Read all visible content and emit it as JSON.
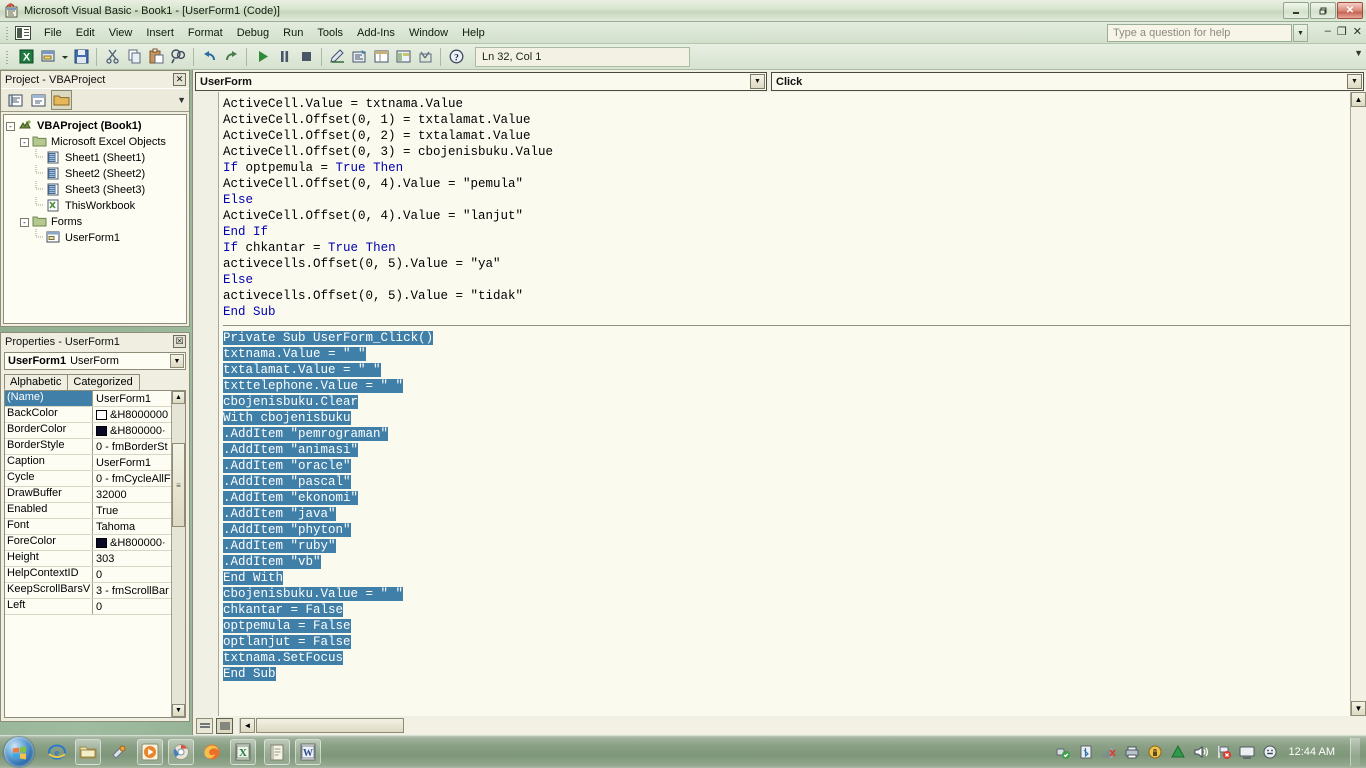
{
  "window": {
    "title": "Microsoft Visual Basic - Book1 - [UserForm1 (Code)]",
    "app_icon": "visual-basic-icon",
    "minimize": "–",
    "maximize": "❐",
    "close": "✕"
  },
  "menu": {
    "items": [
      {
        "label": "File",
        "accel": "F"
      },
      {
        "label": "Edit",
        "accel": "E"
      },
      {
        "label": "View",
        "accel": "V"
      },
      {
        "label": "Insert",
        "accel": "I"
      },
      {
        "label": "Format",
        "accel": "o"
      },
      {
        "label": "Debug",
        "accel": "D"
      },
      {
        "label": "Run",
        "accel": "R"
      },
      {
        "label": "Tools",
        "accel": "T"
      },
      {
        "label": "Add-Ins",
        "accel": "A"
      },
      {
        "label": "Window",
        "accel": "W"
      },
      {
        "label": "Help",
        "accel": "H"
      }
    ],
    "help_placeholder": "Type a question for help",
    "mdi_minimize": "–",
    "mdi_restore": "❐",
    "mdi_close": "✕"
  },
  "toolbar": {
    "position_label": "Ln 32, Col 1",
    "buttons": [
      "view-excel-icon",
      "insert-userform-icon",
      "save-icon",
      "cut-icon",
      "copy-icon",
      "paste-icon",
      "find-icon",
      "undo-icon",
      "redo-icon",
      "run-icon",
      "break-icon",
      "reset-icon",
      "design-mode-icon",
      "project-explorer-icon",
      "properties-window-icon",
      "object-browser-icon",
      "toolbox-icon",
      "help-icon"
    ]
  },
  "project_panel": {
    "caption": "Project - VBAProject",
    "close_label": "✕",
    "toolbar_buttons": [
      "view-code-icon",
      "view-object-icon",
      "toggle-folders-icon"
    ],
    "tree": [
      {
        "label": "VBAProject (Book1)",
        "icon": "vba-project-icon",
        "depth": 0,
        "expander": "-",
        "bold": true
      },
      {
        "label": "Microsoft Excel Objects",
        "icon": "folder-icon",
        "depth": 1,
        "expander": "-",
        "bold": false
      },
      {
        "label": "Sheet1 (Sheet1)",
        "icon": "worksheet-icon",
        "depth": 2,
        "expander": "",
        "bold": false
      },
      {
        "label": "Sheet2 (Sheet2)",
        "icon": "worksheet-icon",
        "depth": 2,
        "expander": "",
        "bold": false
      },
      {
        "label": "Sheet3 (Sheet3)",
        "icon": "worksheet-icon",
        "depth": 2,
        "expander": "",
        "bold": false
      },
      {
        "label": "ThisWorkbook",
        "icon": "workbook-icon",
        "depth": 2,
        "expander": "",
        "bold": false
      },
      {
        "label": "Forms",
        "icon": "folder-icon",
        "depth": 1,
        "expander": "-",
        "bold": false
      },
      {
        "label": "UserForm1",
        "icon": "userform-icon",
        "depth": 2,
        "expander": "",
        "bold": false
      }
    ]
  },
  "properties_panel": {
    "caption": "Properties - UserForm1",
    "close_label": "☒",
    "object_name": "UserForm1",
    "object_type": "UserForm",
    "tabs": [
      {
        "label": "Alphabetic",
        "selected": true
      },
      {
        "label": "Categorized",
        "selected": false
      }
    ],
    "rows": [
      {
        "name": "(Name)",
        "value": "UserForm1",
        "selected": true,
        "swatch": null
      },
      {
        "name": "BackColor",
        "value": "&H8000000",
        "selected": false,
        "swatch": "#ffffff"
      },
      {
        "name": "BorderColor",
        "value": "&H800000·",
        "selected": false,
        "swatch": "#0a0a28"
      },
      {
        "name": "BorderStyle",
        "value": "0 - fmBorderSt",
        "selected": false,
        "swatch": null
      },
      {
        "name": "Caption",
        "value": "UserForm1",
        "selected": false,
        "swatch": null
      },
      {
        "name": "Cycle",
        "value": "0 - fmCycleAllF",
        "selected": false,
        "swatch": null
      },
      {
        "name": "DrawBuffer",
        "value": "32000",
        "selected": false,
        "swatch": null
      },
      {
        "name": "Enabled",
        "value": "True",
        "selected": false,
        "swatch": null
      },
      {
        "name": "Font",
        "value": "Tahoma",
        "selected": false,
        "swatch": null
      },
      {
        "name": "ForeColor",
        "value": "&H800000·",
        "selected": false,
        "swatch": "#0a0a28"
      },
      {
        "name": "Height",
        "value": "303",
        "selected": false,
        "swatch": null
      },
      {
        "name": "HelpContextID",
        "value": "0",
        "selected": false,
        "swatch": null
      },
      {
        "name": "KeepScrollBarsV",
        "value": "3 - fmScrollBar",
        "selected": false,
        "swatch": null
      },
      {
        "name": "Left",
        "value": "0",
        "selected": false,
        "swatch": null
      }
    ]
  },
  "code_window": {
    "object_combo": "UserForm",
    "procedure_combo": "Click",
    "arrow": "▼",
    "lines": [
      {
        "text": "ActiveCell.Value = txtnama.Value",
        "selected": false,
        "kw": []
      },
      {
        "text": "ActiveCell.Offset(0, 1) = txtalamat.Value",
        "selected": false,
        "kw": []
      },
      {
        "text": "ActiveCell.Offset(0, 2) = txtalamat.Value",
        "selected": false,
        "kw": []
      },
      {
        "text": "ActiveCell.Offset(0, 3) = cbojenisbuku.Value",
        "selected": false,
        "kw": []
      },
      {
        "text": "If optpemula = True Then",
        "selected": false,
        "kw": [
          "If",
          "True",
          "Then"
        ]
      },
      {
        "text": "ActiveCell.Offset(0, 4).Value = \"pemula\"",
        "selected": false,
        "kw": []
      },
      {
        "text": "Else",
        "selected": false,
        "kw": [
          "Else"
        ]
      },
      {
        "text": "ActiveCell.Offset(0, 4).Value = \"lanjut\"",
        "selected": false,
        "kw": []
      },
      {
        "text": "End If",
        "selected": false,
        "kw": [
          "End",
          "If"
        ]
      },
      {
        "text": "If chkantar = True Then",
        "selected": false,
        "kw": [
          "If",
          "True",
          "Then"
        ]
      },
      {
        "text": "activecells.Offset(0, 5).Value = \"ya\"",
        "selected": false,
        "kw": []
      },
      {
        "text": "Else",
        "selected": false,
        "kw": [
          "Else"
        ]
      },
      {
        "text": "activecells.Offset(0, 5).Value = \"tidak\"",
        "selected": false,
        "kw": []
      },
      {
        "text": "End Sub",
        "selected": false,
        "kw": [
          "End",
          "Sub"
        ]
      },
      {
        "separator": true
      },
      {
        "text": "Private Sub UserForm_Click()",
        "selected": true,
        "kw": [
          "Private",
          "Sub"
        ]
      },
      {
        "text": "txtnama.Value = \" \"",
        "selected": true,
        "kw": []
      },
      {
        "text": "txtalamat.Value = \" \"",
        "selected": true,
        "kw": []
      },
      {
        "text": "txttelephone.Value = \" \"",
        "selected": true,
        "kw": []
      },
      {
        "text": "cbojenisbuku.Clear",
        "selected": true,
        "kw": []
      },
      {
        "text": "With cbojenisbuku",
        "selected": true,
        "kw": [
          "With"
        ]
      },
      {
        "text": ".AddItem \"pemrograman\"",
        "selected": true,
        "kw": []
      },
      {
        "text": ".AddItem \"animasi\"",
        "selected": true,
        "kw": []
      },
      {
        "text": ".AddItem \"oracle\"",
        "selected": true,
        "kw": []
      },
      {
        "text": ".AddItem \"pascal\"",
        "selected": true,
        "kw": []
      },
      {
        "text": ".AddItem \"ekonomi\"",
        "selected": true,
        "kw": []
      },
      {
        "text": ".AddItem \"java\"",
        "selected": true,
        "kw": []
      },
      {
        "text": ".AddItem \"phyton\"",
        "selected": true,
        "kw": []
      },
      {
        "text": ".AddItem \"ruby\"",
        "selected": true,
        "kw": []
      },
      {
        "text": ".AddItem \"vb\"",
        "selected": true,
        "kw": []
      },
      {
        "text": "End With",
        "selected": true,
        "kw": [
          "End",
          "With"
        ]
      },
      {
        "text": "cbojenisbuku.Value = \" \"",
        "selected": true,
        "kw": []
      },
      {
        "text": "chkantar = False",
        "selected": true,
        "kw": [
          "False"
        ]
      },
      {
        "text": "optpemula = False",
        "selected": true,
        "kw": [
          "False"
        ]
      },
      {
        "text": "optlanjut = False",
        "selected": true,
        "kw": [
          "False"
        ]
      },
      {
        "text": "txtnama.SetFocus",
        "selected": true,
        "kw": []
      },
      {
        "text": "End Sub",
        "selected": true,
        "kw": [
          "End",
          "Sub"
        ]
      }
    ],
    "view_buttons": [
      "procedure-view-icon",
      "full-module-view-icon"
    ],
    "scroll_up": "▲",
    "scroll_down": "▼",
    "scroll_left": "◄",
    "scroll_right": "►"
  },
  "taskbar": {
    "start": "windows-start-orb",
    "quick_launch": [
      "internet-explorer-icon",
      "windows-explorer-icon",
      "media-player-skin-icon",
      "media-player-icon",
      "chrome-icon",
      "firefox-icon",
      "excel-icon"
    ],
    "tasks": [
      "notepad-task-icon",
      "word-task-icon"
    ],
    "tray": [
      "usb-safe-remove-icon",
      "bluetooth-icon",
      "network-disconnected-icon",
      "speaker-printer-icon",
      "security-shield-icon",
      "triangle-icon",
      "volume-icon",
      "flag-error-icon",
      "display-icon",
      "smiley-icon"
    ],
    "clock": "12:44 AM"
  },
  "colors": {
    "selection_bg": "#3f7fa8",
    "keyword": "#0000b0",
    "code_bg": "#fbfaee",
    "chrome_bg": "#efeee0"
  }
}
